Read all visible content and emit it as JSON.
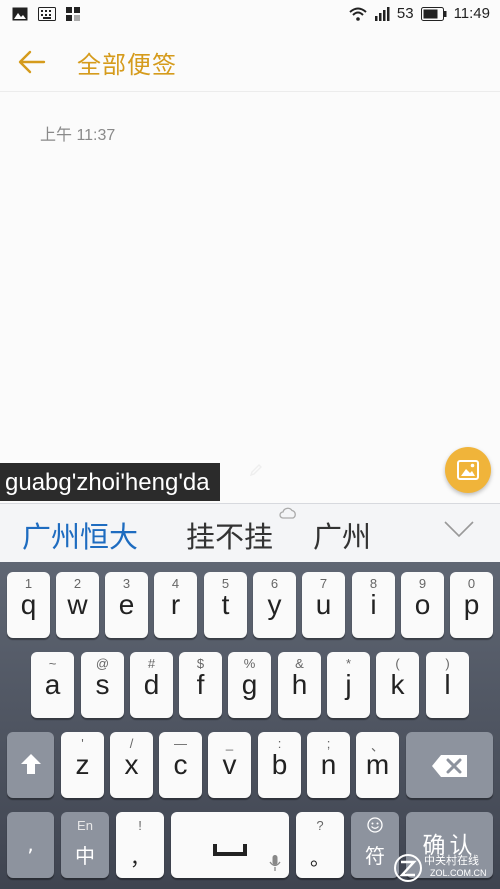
{
  "status_bar": {
    "signal": "53",
    "time": "11:49"
  },
  "header": {
    "title": "全部便签"
  },
  "note": {
    "time": "上午 11:37"
  },
  "ime": {
    "composing": "guabg'zhoi'heng'da",
    "candidates": [
      "广州恒大",
      "挂不挂",
      "广州"
    ]
  },
  "keyboard": {
    "row1": [
      {
        "hint": "1",
        "key": "q"
      },
      {
        "hint": "2",
        "key": "w"
      },
      {
        "hint": "3",
        "key": "e"
      },
      {
        "hint": "4",
        "key": "r"
      },
      {
        "hint": "5",
        "key": "t"
      },
      {
        "hint": "6",
        "key": "y"
      },
      {
        "hint": "7",
        "key": "u"
      },
      {
        "hint": "8",
        "key": "i"
      },
      {
        "hint": "9",
        "key": "o"
      },
      {
        "hint": "0",
        "key": "p"
      }
    ],
    "row2": [
      {
        "hint": "~",
        "key": "a"
      },
      {
        "hint": "@",
        "key": "s"
      },
      {
        "hint": "#",
        "key": "d"
      },
      {
        "hint": "$",
        "key": "f"
      },
      {
        "hint": "%",
        "key": "g"
      },
      {
        "hint": "&",
        "key": "h"
      },
      {
        "hint": "*",
        "key": "j"
      },
      {
        "hint": "(",
        "key": "k"
      },
      {
        "hint": ")",
        "key": "l"
      }
    ],
    "row3": [
      {
        "hint": "'",
        "key": "z"
      },
      {
        "hint": "/",
        "key": "x"
      },
      {
        "hint": "—",
        "key": "c"
      },
      {
        "hint": "_",
        "key": "v"
      },
      {
        "hint": ":",
        "key": "b"
      },
      {
        "hint": ";",
        "key": "n"
      },
      {
        "hint": "、",
        "key": "m"
      }
    ],
    "comma_key": ",",
    "lang_hint": "En",
    "lang_main": "中",
    "punct_hint": "!",
    "punct_main": "，",
    "period_hint": "?",
    "period_main": "。",
    "symbol_label": "符",
    "confirm_label": "确认"
  },
  "watermark": {
    "text": "中关村在线",
    "sub": "ZOL.COM.CN"
  },
  "colors": {
    "accent": "#d59b1c",
    "fab": "#f0b43a",
    "candidate_highlight": "#1e6cc0"
  }
}
